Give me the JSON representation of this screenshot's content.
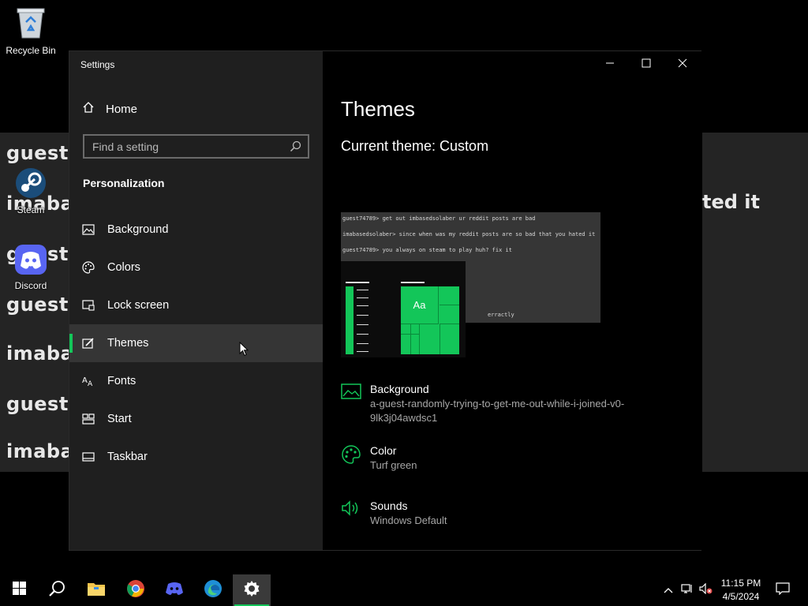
{
  "desktop": {
    "icons": [
      {
        "label": "Recycle Bin",
        "icon": "recycle-bin-icon"
      },
      {
        "label": "Steam",
        "icon": "steam-icon"
      },
      {
        "label": "Discord",
        "icon": "discord-icon"
      }
    ],
    "wallpaper_text": {
      "left": [
        "guest7",
        "imabas",
        "guest7",
        "guest7",
        "imabas",
        "guest7",
        "imabas"
      ],
      "right": "ted it"
    }
  },
  "window": {
    "title": "Settings",
    "controls": [
      "minimize-icon",
      "maximize-icon",
      "close-icon"
    ]
  },
  "nav": {
    "home": "Home",
    "search_placeholder": "Find a setting",
    "section": "Personalization",
    "items": [
      {
        "label": "Background",
        "icon": "picture-icon"
      },
      {
        "label": "Colors",
        "icon": "palette-icon"
      },
      {
        "label": "Lock screen",
        "icon": "lock-screen-icon"
      },
      {
        "label": "Themes",
        "icon": "brush-icon",
        "selected": true
      },
      {
        "label": "Fonts",
        "icon": "font-icon"
      },
      {
        "label": "Start",
        "icon": "start-icon"
      },
      {
        "label": "Taskbar",
        "icon": "taskbar-icon"
      }
    ]
  },
  "content": {
    "title": "Themes",
    "current_theme": "Current theme: Custom",
    "preview": {
      "lines": [
        "guest74789> get out imbasedsolaber ur reddit posts are bad",
        "imabasedsolaber> since when was my reddit posts are so bad that you hated it",
        "guest74789> you always on steam to play huh? fix it"
      ],
      "tile_label": "Aa",
      "overlay_text": "erractly"
    },
    "options": [
      {
        "title": "Background",
        "value": "a-guest-randomly-trying-to-get-me-out-while-i-joined-v0-9lk3j04awdsc1",
        "icon": "picture-icon"
      },
      {
        "title": "Color",
        "value": "Turf green",
        "icon": "palette-icon"
      },
      {
        "title": "Sounds",
        "value": "Windows Default",
        "icon": "speaker-icon"
      }
    ]
  },
  "taskbar": {
    "apps": [
      "windows-start-icon",
      "search-icon",
      "file-explorer-icon",
      "chrome-icon",
      "discord-icon",
      "edge-icon",
      "settings-gear-icon"
    ],
    "active_app": "settings-gear-icon",
    "tray": [
      "chevron-up-icon",
      "network-icon",
      "volume-muted-icon"
    ],
    "time": "11:15 PM",
    "date": "4/5/2024",
    "notification": "notification-icon"
  },
  "colors": {
    "accent": "#13c659",
    "nav_bg": "#1f1f1f",
    "content_bg": "#000000",
    "wallpaper_bg": "#242424"
  }
}
